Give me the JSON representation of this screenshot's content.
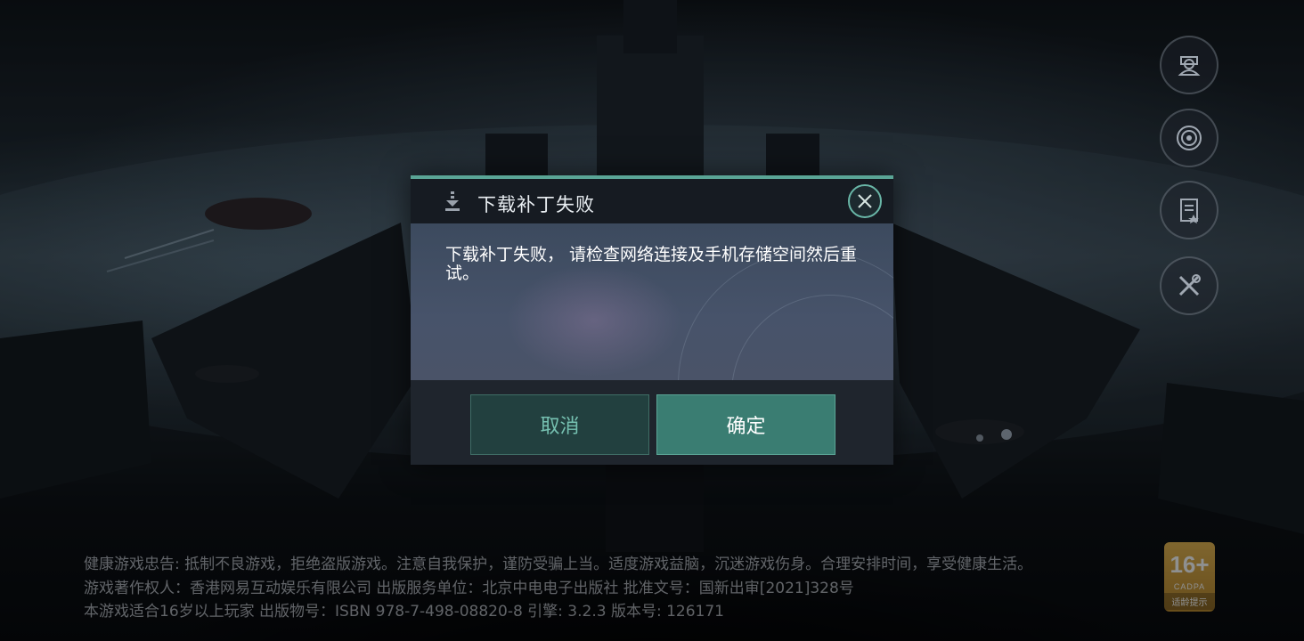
{
  "dialog": {
    "title": "下载补丁失败",
    "message": "下载补丁失败， 请检查网络连接及手机存储空间然后重试。",
    "cancel_label": "取消",
    "confirm_label": "确定",
    "icons": {
      "title": "download-icon",
      "close": "close-icon"
    }
  },
  "side_buttons": [
    {
      "name": "account-icon"
    },
    {
      "name": "broadcast-icon"
    },
    {
      "name": "notice-icon"
    },
    {
      "name": "repair-tools-icon"
    }
  ],
  "legal": {
    "line1": "健康游戏忠告: 抵制不良游戏，拒绝盗版游戏。注意自我保护，谨防受骗上当。适度游戏益脑，沉迷游戏伤身。合理安排时间，享受健康生活。",
    "line2": "游戏著作权人：香港网易互动娱乐有限公司 出版服务单位：北京中电电子出版社 批准文号：国新出审[2021]328号",
    "line3": "本游戏适合16岁以上玩家     出版物号：ISBN 978-7-498-08820-8     引擎: 3.2.3     版本号: 126171"
  },
  "age_rating": {
    "label": "16+",
    "org": "CADPA",
    "tip": "适龄提示"
  },
  "colors": {
    "accent": "#5aa596",
    "cancel_text": "#76c1b1",
    "confirm_bg": "#3a7d72"
  }
}
